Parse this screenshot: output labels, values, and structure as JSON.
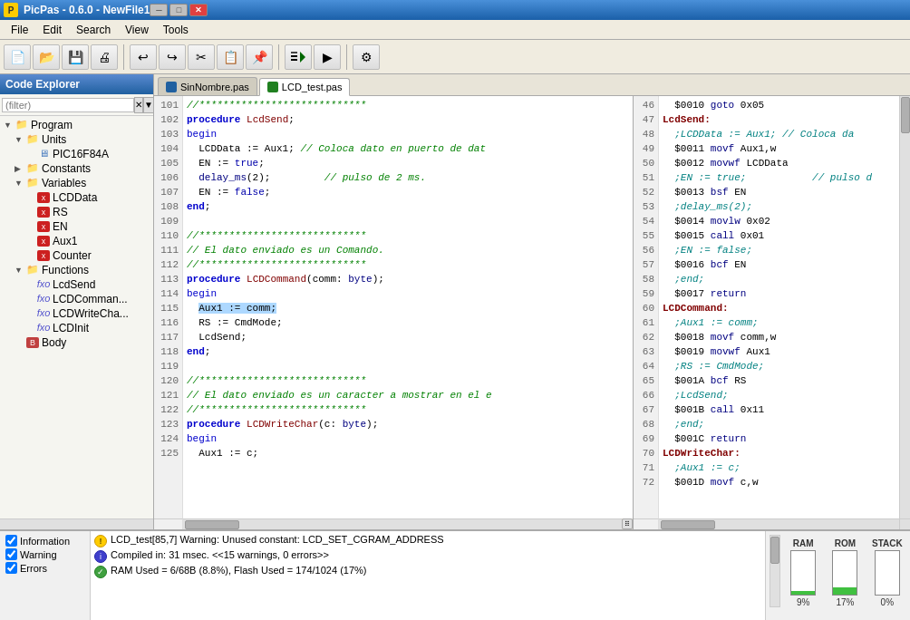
{
  "titlebar": {
    "title": "PicPas - 0.6.0 - NewFile1",
    "icon_text": "P"
  },
  "menubar": {
    "items": [
      "File",
      "Edit",
      "Search",
      "View",
      "Tools"
    ]
  },
  "sidebar": {
    "header": "Code Explorer",
    "filter_placeholder": "(filter)",
    "tree": [
      {
        "id": "program",
        "label": "Program",
        "indent": 0,
        "type": "folder",
        "expanded": true
      },
      {
        "id": "units",
        "label": "Units",
        "indent": 1,
        "type": "folder",
        "expanded": true
      },
      {
        "id": "pic16f84a",
        "label": "PIC16F84A",
        "indent": 2,
        "type": "cpu"
      },
      {
        "id": "constants",
        "label": "Constants",
        "indent": 1,
        "type": "folder",
        "expanded": false
      },
      {
        "id": "variables",
        "label": "Variables",
        "indent": 1,
        "type": "folder",
        "expanded": true
      },
      {
        "id": "lcddata",
        "label": "LCDData",
        "indent": 2,
        "type": "var"
      },
      {
        "id": "rs",
        "label": "RS",
        "indent": 2,
        "type": "var"
      },
      {
        "id": "en",
        "label": "EN",
        "indent": 2,
        "type": "var"
      },
      {
        "id": "aux1",
        "label": "Aux1",
        "indent": 2,
        "type": "var"
      },
      {
        "id": "counter",
        "label": "Counter",
        "indent": 2,
        "type": "var"
      },
      {
        "id": "functions",
        "label": "Functions",
        "indent": 1,
        "type": "folder",
        "expanded": true
      },
      {
        "id": "lcdsend",
        "label": "LcdSend",
        "indent": 2,
        "type": "func"
      },
      {
        "id": "lcdcommand",
        "label": "LCDComman...",
        "indent": 2,
        "type": "func"
      },
      {
        "id": "lcdwritechar",
        "label": "LCDWriteCha...",
        "indent": 2,
        "type": "func"
      },
      {
        "id": "lcdinit",
        "label": "LCDInit",
        "indent": 2,
        "type": "func"
      },
      {
        "id": "body",
        "label": "Body",
        "indent": 1,
        "type": "body"
      }
    ]
  },
  "tabs": [
    {
      "label": "SinNombre.pas",
      "active": false,
      "color": "blue"
    },
    {
      "label": "LCD_test.pas",
      "active": true,
      "color": "green"
    }
  ],
  "editor": {
    "left_lines": [
      "101",
      "102",
      "103",
      "104",
      "105",
      "106",
      "107",
      "108",
      "109",
      "110",
      "111",
      "112",
      "113",
      "114",
      "115",
      "116",
      "117",
      "118",
      "119",
      "120",
      "121",
      "122",
      "123",
      "124",
      "125"
    ],
    "left_code": [
      "//****************************",
      "procedure LcdSend;",
      "begin",
      "  LCDData := Aux1; // Coloca dato en puerto de dat",
      "  EN := true;",
      "  delay_ms(2);         // pulso de 2 ms.",
      "  EN := false;",
      "end;",
      "",
      "//****************************",
      "// El dato enviado es un Comando.",
      "//****************************",
      "procedure LCDCommand(comm: byte);",
      "begin",
      "  Aux1 := comm;",
      "  RS := CmdMode;",
      "  LcdSend;",
      "end;",
      "",
      "//****************************",
      "// El dato enviado es un caracter a mostrar en el e",
      "//****************************",
      "procedure LCDWriteChar(c: byte);",
      "begin",
      "  Aux1 := c;"
    ],
    "right_lines": [
      "46",
      "47",
      "48",
      "49",
      "50",
      "51",
      "52",
      "53",
      "54",
      "55",
      "56",
      "57",
      "58",
      "59",
      "60",
      "61",
      "62",
      "63",
      "64",
      "65",
      "66",
      "67",
      "68",
      "69",
      "70",
      "71",
      "72"
    ],
    "right_code": [
      "  $0010 goto 0x05",
      "LcdSend:",
      "  ;LCDData := Aux1; // Coloca da",
      "  $0011 movf Aux1,w",
      "  $0012 movwf LCDData",
      "  ;EN := true;           // pulso d",
      "  $0013 bsf EN",
      "  ;delay_ms(2);",
      "  $0014 movlw 0x02",
      "  $0015 call 0x01",
      "  ;EN := false;",
      "  $0016 bcf EN",
      "  ;end;",
      "  $0017 return",
      "LCDCommand:",
      "  ;Aux1 := comm;",
      "  $0018 movf comm,w",
      "  $0019 movwf Aux1",
      "  ;RS := CmdMode;",
      "  $001A bcf RS",
      "  ;LcdSend;",
      "  $001B call 0x11",
      "  ;end;",
      "  $001C return",
      "LCDWriteChar:",
      "  ;Aux1 := c;",
      "  $001D movf c,w"
    ]
  },
  "log": {
    "checks": [
      {
        "id": "information",
        "label": "Information",
        "checked": true
      },
      {
        "id": "warning",
        "label": "Warning",
        "checked": true
      },
      {
        "id": "errors",
        "label": "Errors",
        "checked": true
      }
    ],
    "messages": [
      {
        "type": "warn",
        "text": "LCD_test[85,7]  Warning: Unused constant: LCD_SET_CGRAM_ADDRESS"
      },
      {
        "type": "info",
        "text": "Compiled in: 31 msec.  <<15 warnings, 0 errors>>"
      },
      {
        "type": "ok",
        "text": "RAM Used   = 6/68B (8.8%), Flash Used = 174/1024 (17%)"
      }
    ]
  },
  "memory": {
    "labels": [
      "RAM",
      "ROM",
      "STACK"
    ],
    "values": [
      9,
      17,
      0
    ],
    "percents": [
      "9%",
      "17%",
      "0%"
    ]
  }
}
